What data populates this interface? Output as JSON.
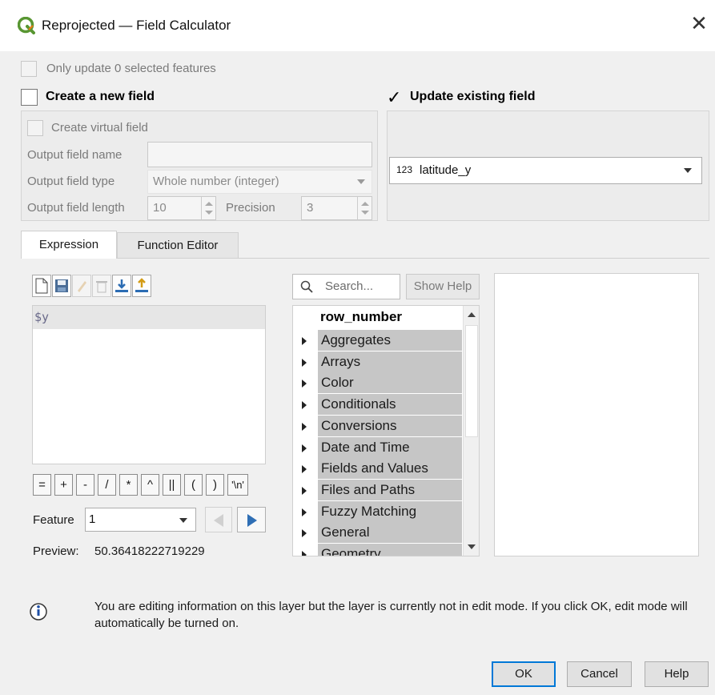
{
  "window": {
    "title": "Reprojected — Field Calculator",
    "close": "✕"
  },
  "only_update": {
    "label": "Only update 0 selected features"
  },
  "create_new_field": {
    "label": "Create a new field",
    "checked": false
  },
  "update_existing": {
    "label": "Update existing field",
    "checked": true,
    "checkmark": "✓"
  },
  "new_field": {
    "virtual_label": "Create virtual field",
    "name_label": "Output field name",
    "name_value": "",
    "type_label": "Output field type",
    "type_value": "Whole number (integer)",
    "length_label": "Output field length",
    "length_value": "10",
    "precision_label": "Precision",
    "precision_value": "3"
  },
  "existing_field": {
    "type_badge": "123",
    "value": "latitude_y"
  },
  "tabs": [
    {
      "label": "Expression",
      "active": true
    },
    {
      "label": "Function Editor",
      "active": false
    }
  ],
  "toolbar_icons": [
    "new-file-icon",
    "save-icon",
    "edit-icon",
    "delete-icon",
    "import-icon",
    "export-icon"
  ],
  "expression": {
    "text": "$y"
  },
  "operators": [
    "=",
    "+",
    "-",
    "/",
    "*",
    "^",
    "||",
    "(",
    ")",
    "'\\n'"
  ],
  "feature": {
    "label": "Feature",
    "value": "1"
  },
  "preview": {
    "label": "Preview:",
    "value": "50.36418222719229"
  },
  "search": {
    "placeholder": "Search...",
    "show_help": "Show Help"
  },
  "function_tree": {
    "first": "row_number",
    "groups": [
      "Aggregates",
      "Arrays",
      "Color",
      "Conditionals",
      "Conversions",
      "Date and Time",
      "Fields and Values",
      "Files and Paths",
      "Fuzzy Matching",
      "General",
      "Geometry"
    ]
  },
  "info": {
    "text": "You are editing information on this layer but the layer is currently not in edit mode. If you click OK, edit mode will automatically be turned on."
  },
  "buttons": {
    "ok": "OK",
    "cancel": "Cancel",
    "help": "Help"
  },
  "colors": {
    "accent": "#0078d7",
    "logo_green": "#589632",
    "nav_blue": "#2f6fb5"
  }
}
